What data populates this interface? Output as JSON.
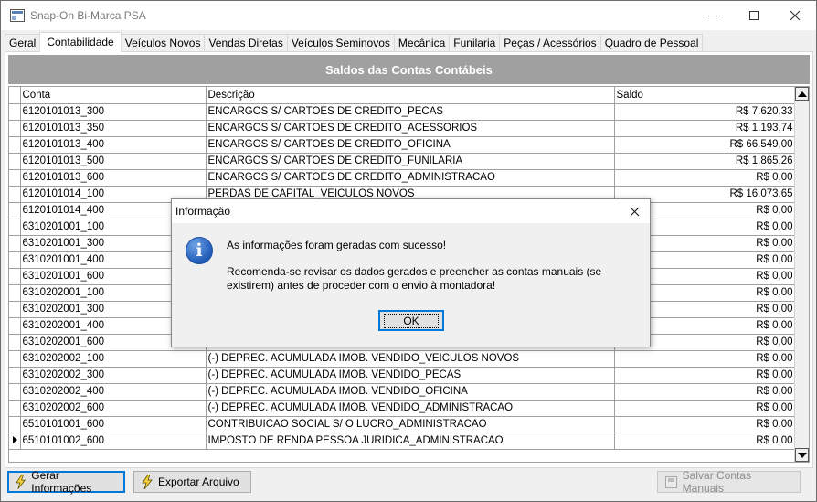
{
  "window": {
    "title": "Snap-On Bi-Marca PSA",
    "icon": "app-window-icon"
  },
  "tabs": [
    {
      "label": "Geral",
      "active": false
    },
    {
      "label": "Contabilidade",
      "active": true
    },
    {
      "label": "Veículos Novos",
      "active": false
    },
    {
      "label": "Vendas Diretas",
      "active": false
    },
    {
      "label": "Veículos Seminovos",
      "active": false
    },
    {
      "label": "Mecânica",
      "active": false
    },
    {
      "label": "Funilaria",
      "active": false
    },
    {
      "label": "Peças / Acessórios",
      "active": false
    },
    {
      "label": "Quadro de Pessoal",
      "active": false
    }
  ],
  "grid": {
    "title": "Saldos das Contas Contábeis",
    "columns": [
      "Conta",
      "Descrição",
      "Saldo"
    ],
    "rows": [
      [
        "6120101013_300",
        "ENCARGOS S/ CARTOES DE CREDITO_PECAS",
        "R$ 7.620,33"
      ],
      [
        "6120101013_350",
        "ENCARGOS S/ CARTOES DE CREDITO_ACESSORIOS",
        "R$ 1.193,74"
      ],
      [
        "6120101013_400",
        "ENCARGOS S/ CARTOES DE CREDITO_OFICINA",
        "R$ 66.549,00"
      ],
      [
        "6120101013_500",
        "ENCARGOS S/ CARTOES DE CREDITO_FUNILARIA",
        "R$ 1.865,26"
      ],
      [
        "6120101013_600",
        "ENCARGOS S/ CARTOES DE CREDITO_ADMINISTRACAO",
        "R$ 0,00"
      ],
      [
        "6120101014_100",
        "PERDAS DE CAPITAL_VEICULOS NOVOS",
        "R$ 16.073,65"
      ],
      [
        "6120101014_400",
        "",
        "R$ 0,00"
      ],
      [
        "6310201001_100",
        "",
        "R$ 0,00"
      ],
      [
        "6310201001_300",
        "",
        "R$ 0,00"
      ],
      [
        "6310201001_400",
        "",
        "R$ 0,00"
      ],
      [
        "6310201001_600",
        "",
        "R$ 0,00"
      ],
      [
        "6310202001_100",
        "",
        "R$ 0,00"
      ],
      [
        "6310202001_300",
        "",
        "R$ 0,00"
      ],
      [
        "6310202001_400",
        "",
        "R$ 0,00"
      ],
      [
        "6310202001_600",
        "",
        "R$ 0,00"
      ],
      [
        "6310202002_100",
        "(-) DEPREC. ACUMULADA IMOB. VENDIDO_VEICULOS NOVOS",
        "R$ 0,00"
      ],
      [
        "6310202002_300",
        "(-) DEPREC. ACUMULADA IMOB. VENDIDO_PECAS",
        "R$ 0,00"
      ],
      [
        "6310202002_400",
        "(-) DEPREC. ACUMULADA IMOB. VENDIDO_OFICINA",
        "R$ 0,00"
      ],
      [
        "6310202002_600",
        "(-) DEPREC. ACUMULADA IMOB. VENDIDO_ADMINISTRACAO",
        "R$ 0,00"
      ],
      [
        "6510101001_600",
        "CONTRIBUICAO SOCIAL S/ O LUCRO_ADMINISTRACAO",
        "R$ 0,00"
      ],
      [
        "6510101002_600",
        "IMPOSTO DE RENDA PESSOA JURIDICA_ADMINISTRACAO",
        "R$ 0,00"
      ]
    ],
    "current_row_index": 20
  },
  "buttons": {
    "gerar": "Gerar Informações",
    "exportar": "Exportar Arquivo",
    "salvar": "Salvar Contas Manuais"
  },
  "dialog": {
    "title": "Informação",
    "message1": "As informações foram geradas com sucesso!",
    "message2": "Recomenda-se revisar os dados gerados e preencher as contas manuais (se existirem) antes de proceder com o envio à montadora!",
    "ok": "OK"
  },
  "colors": {
    "grid_header_bg": "#a0a0a0",
    "focus_blue": "#0078d7",
    "info_icon_blue": "#1f5bb8"
  }
}
